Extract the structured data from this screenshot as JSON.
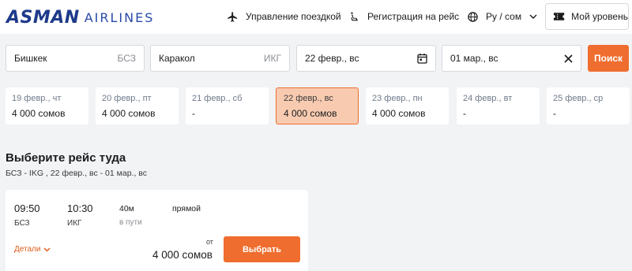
{
  "header": {
    "logo_main": "ASMAN",
    "logo_sub": "AIRLINES",
    "manage_booking": "Управление поездкой",
    "checkin": "Регистрация на рейс",
    "language": "Ру / сом",
    "my_level": "Мой уровень"
  },
  "search": {
    "from_city": "Бишкек",
    "from_code": "БСЗ",
    "to_city": "Каракол",
    "to_code": "ИКГ",
    "departure": "22 февр., вс",
    "return": "01 мар., вс",
    "search_label": "Поиск"
  },
  "dates": [
    {
      "date": "19 февр., чт",
      "price": "4 000 сомов"
    },
    {
      "date": "20 февр., пт",
      "price": "4 000 сомов"
    },
    {
      "date": "21 февр., сб",
      "price": "-"
    },
    {
      "date": "22 февр., вс",
      "price": "4 000 сомов",
      "selected": true
    },
    {
      "date": "23 февр., пн",
      "price": "4 000 сомов"
    },
    {
      "date": "24 февр., вт",
      "price": "-"
    },
    {
      "date": "25 февр., ср",
      "price": "-"
    }
  ],
  "section": {
    "title": "Выберите рейс туда",
    "subtitle": "БСЗ - IKG , 22 февр., вс - 01 мар., вс"
  },
  "flight": {
    "dep_time": "09:50",
    "dep_code": "БСЗ",
    "arr_time": "10:30",
    "arr_code": "ИКГ",
    "duration": "40м",
    "duration_label": "в пути",
    "type": "прямой",
    "details_label": "Детали",
    "from_label": "от",
    "price": "4 000 сомов",
    "choose_label": "Выбрать"
  },
  "colors": {
    "accent": "#ef6d2e",
    "selected_bg": "#f8cbb1",
    "brand": "#1e3a8a"
  }
}
